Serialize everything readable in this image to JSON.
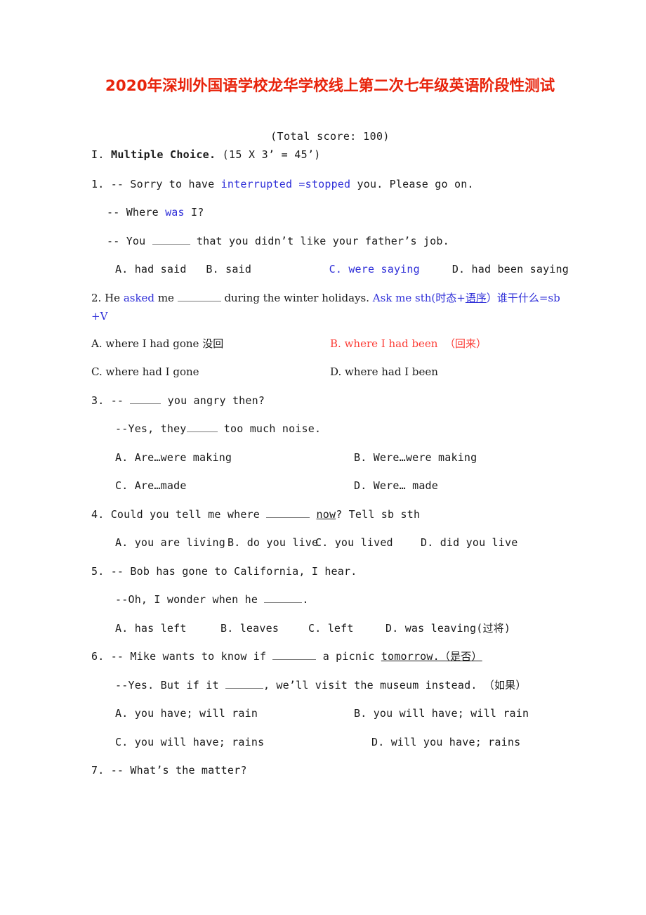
{
  "document": {
    "title": "2020年深圳外国语学校龙华学校线上第二次七年级英语阶段性测试",
    "total_score_line": "(Total score: 100)",
    "section_number": "I.",
    "section_title": "Multiple Choice.",
    "section_points": "(15 X 3’ = 45’)"
  },
  "colors": {
    "title_red": "#e8240c",
    "accent_blue": "#2f2fd8",
    "accent_red": "#fb3b34",
    "body_text": "#1a1a1a"
  },
  "questions": [
    {
      "number": "1.",
      "stem_a_pre": "-- Sorry to have ",
      "stem_a_blue": "interrupted =stopped",
      "stem_a_post": " you. Please go on.",
      "stem_b_pre": "-- Where ",
      "stem_b_blue": "was",
      "stem_b_post": " I?",
      "stem_c_pre": "-- You ",
      "stem_c_post": " that you didn’t like your father’s job.",
      "options": [
        {
          "label": "A.",
          "text": "had said"
        },
        {
          "label": "B.",
          "text": "said"
        },
        {
          "label": "C.",
          "text": "were saying"
        },
        {
          "label": "D.",
          "text": "had been saying"
        }
      ]
    },
    {
      "number": "2.",
      "stem_pre": "He ",
      "stem_blue_word": "asked",
      "stem_mid": " me ",
      "stem_post": " during the winter holidays. ",
      "note_pre": "Ask me sth(时态+",
      "note_underline": "语序",
      "note_post": "）谁干什么=sb",
      "note_wrap": "+V",
      "options": [
        {
          "label": "A.",
          "text": "where I had gone 没回"
        },
        {
          "label": "B.",
          "text": "where I had been",
          "extra": "（回来）"
        },
        {
          "label": "C.",
          "text": "where had I gone"
        },
        {
          "label": "D.",
          "text": "where had I been"
        }
      ]
    },
    {
      "number": "3.",
      "stem_a_pre": "-- ",
      "stem_a_post": " you angry then?",
      "stem_b_pre": "--Yes, they",
      "stem_b_post": " too much noise.",
      "options": [
        {
          "label": "A.",
          "text": "Are…were making"
        },
        {
          "label": "B.",
          "text": "Were…were making"
        },
        {
          "label": "C.",
          "text": "Are…made"
        },
        {
          "label": "D.",
          "text": "Were… made"
        }
      ]
    },
    {
      "number": "4.",
      "stem_pre": "Could you tell me where ",
      "stem_underline": "now",
      "stem_post": "? Tell sb sth",
      "options": [
        {
          "label": "A.",
          "text": "you are living"
        },
        {
          "label": "B.",
          "text": "do you live"
        },
        {
          "label": "C.",
          "text": "you lived"
        },
        {
          "label": "D.",
          "text": "did you live"
        }
      ]
    },
    {
      "number": "5.",
      "stem_a": "-- Bob has gone to California, I hear.",
      "stem_b_pre": "--Oh, I wonder when he ",
      "stem_b_post": ".",
      "options": [
        {
          "label": "A.",
          "text": "has left"
        },
        {
          "label": "B.",
          "text": "leaves"
        },
        {
          "label": "C.",
          "text": "left"
        },
        {
          "label": "D.",
          "text": "was leaving(过将)"
        }
      ]
    },
    {
      "number": "6.",
      "stem_a_pre": "-- Mike wants to know if ",
      "stem_a_mid": " a picnic ",
      "stem_a_underline": "tomorrow.（是否）",
      "stem_b_pre": "--Yes. But if it ",
      "stem_b_post": ", we’ll visit the museum instead. （如果）",
      "options": [
        {
          "label": "A.",
          "text": "you have; will rain"
        },
        {
          "label": "B.",
          "text": "you will have; will rain"
        },
        {
          "label": "C.",
          "text": "you will have; rains"
        },
        {
          "label": "D.",
          "text": "will you have; rains"
        }
      ]
    },
    {
      "number": "7.",
      "stem_a": "-- What’s the matter?"
    }
  ]
}
